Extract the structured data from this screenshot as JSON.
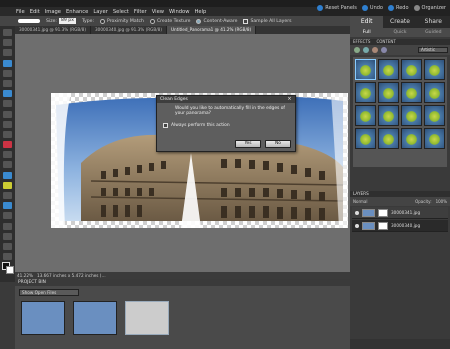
{
  "app": {
    "top_right": {
      "reset_panels": "Reset Panels",
      "undo": "Undo",
      "redo": "Redo",
      "organizer": "Organizer"
    }
  },
  "menu": [
    "File",
    "Edit",
    "Image",
    "Enhance",
    "Layer",
    "Select",
    "Filter",
    "View",
    "Window",
    "Help"
  ],
  "options": {
    "size_label": "Size:",
    "size_value": "89 px",
    "type_label": "Type:",
    "type_options": [
      "Proximity Match",
      "Create Texture",
      "Content-Aware"
    ],
    "type_selected": "Content-Aware",
    "sample_all_layers": "Sample All Layers"
  },
  "doc_tabs": [
    {
      "label": "30000341.jpg @ 91.3% (RGB/8)",
      "active": false
    },
    {
      "label": "30000340.jpg @ 91.3% (RGB/8)",
      "active": false
    },
    {
      "label": "Untitled_Panorama1 @ 41.2% (RGB/8)",
      "active": true
    }
  ],
  "status": {
    "zoom": "41.22%",
    "info": "13.667 inches x 5.472 inches (…"
  },
  "project_bin": {
    "title": "PROJECT BIN",
    "filter": "Show Open Files"
  },
  "dialog": {
    "title": "Clean Edges",
    "message": "Would you like to automatically fill in the edges of your panorama?",
    "checkbox_label": "Always perform this action",
    "yes": "Yes",
    "no": "No"
  },
  "panel": {
    "mode_tabs": [
      {
        "label": "Edit",
        "active": true
      },
      {
        "label": "Create",
        "active": false
      },
      {
        "label": "Share",
        "active": false
      }
    ],
    "sub_tabs": [
      {
        "label": "Full",
        "active": true
      },
      {
        "label": "Quick",
        "active": false
      },
      {
        "label": "Guided",
        "active": false
      }
    ],
    "effects_header": "EFFECTS",
    "content_header": "CONTENT",
    "effects_filter": "Artistic",
    "layers_header": "LAYERS",
    "layers_mode": "Normal",
    "layers_opacity_label": "Opacity:",
    "layers_opacity": "100%",
    "layers": [
      {
        "name": "30000341.jpg",
        "selected": false
      },
      {
        "name": "30000340.jpg",
        "selected": true
      }
    ]
  }
}
